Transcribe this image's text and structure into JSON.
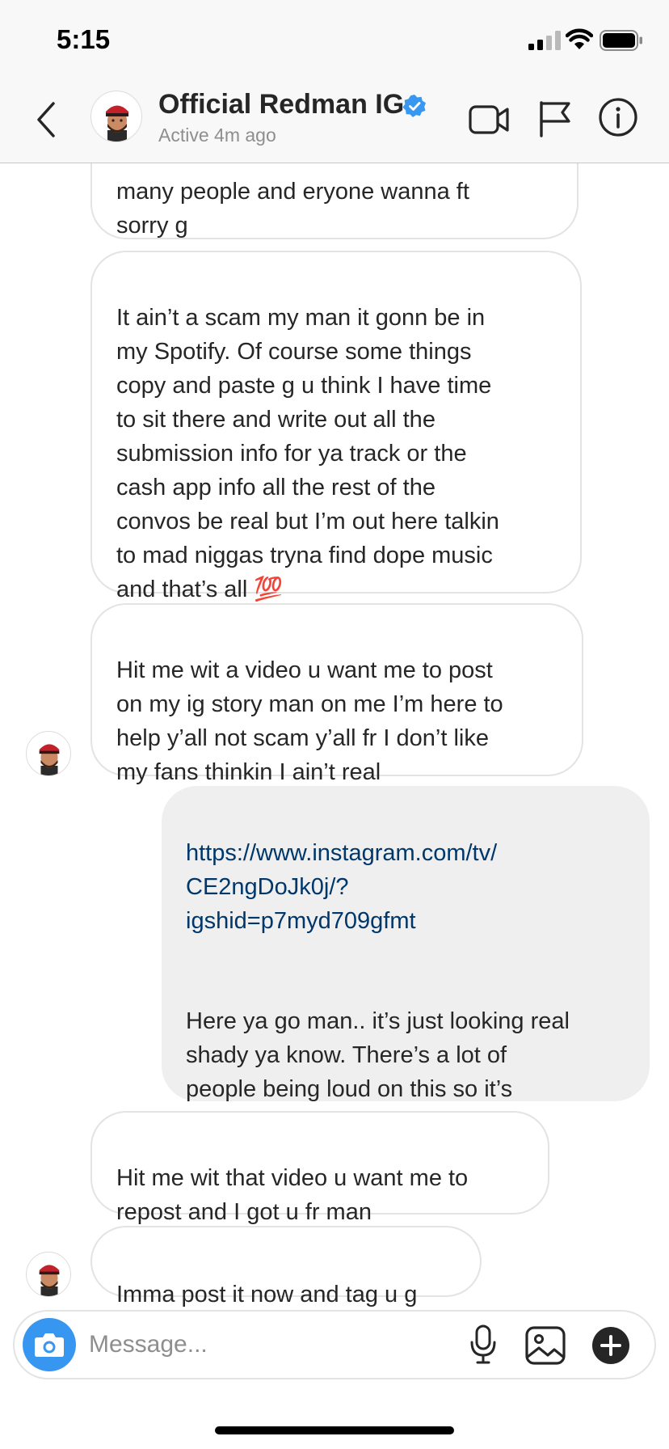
{
  "status_bar": {
    "time": "5:15"
  },
  "header": {
    "contact_name": "Official Redman IG",
    "active_status": "Active 4m ago"
  },
  "messages": [
    {
      "direction": "incoming",
      "text": "many people and eryone wanna ft\nsorry g"
    },
    {
      "direction": "incoming",
      "text": "It ain’t a scam my man it gonn be in\nmy Spotify. Of course some things\ncopy and paste g u think I have time\nto sit there and write out all the\nsubmission info for ya track or the\ncash app info all the rest of the\nconvos be real but I’m out here talkin\nto mad niggas tryna find dope music\nand that’s all 💯"
    },
    {
      "direction": "incoming",
      "text": "Hit me wit a video u want me to post\non my ig story man on me I’m here to\nhelp y’all not scam y’all fr I don’t like\nmy fans thinkin I ain’t real"
    },
    {
      "direction": "outgoing",
      "link": "https://www.instagram.com/tv/\nCE2ngDoJk0j/?\nigshid=p7myd709gfmt",
      "text": "Here ya go man.. it’s just looking real\nshady ya know. There’s a lot of\npeople being loud on this so it’s\nstrange. :/"
    },
    {
      "direction": "incoming",
      "text": "Hit me wit that video u want me to\nrepost and I got u fr man"
    },
    {
      "direction": "incoming",
      "text": "Imma post it now and tag u g"
    }
  ],
  "composer": {
    "placeholder": "Message..."
  },
  "colors": {
    "link": "#00376b",
    "verified": "#3897f0",
    "camera_button": "#3797f0",
    "outgoing_bubble": "#efefef",
    "incoming_border": "#e3e3e3"
  },
  "icons": [
    "back-chevron-icon",
    "verified-badge-icon",
    "video-call-icon",
    "flag-icon",
    "info-icon",
    "camera-icon",
    "microphone-icon",
    "gallery-icon",
    "plus-icon"
  ]
}
